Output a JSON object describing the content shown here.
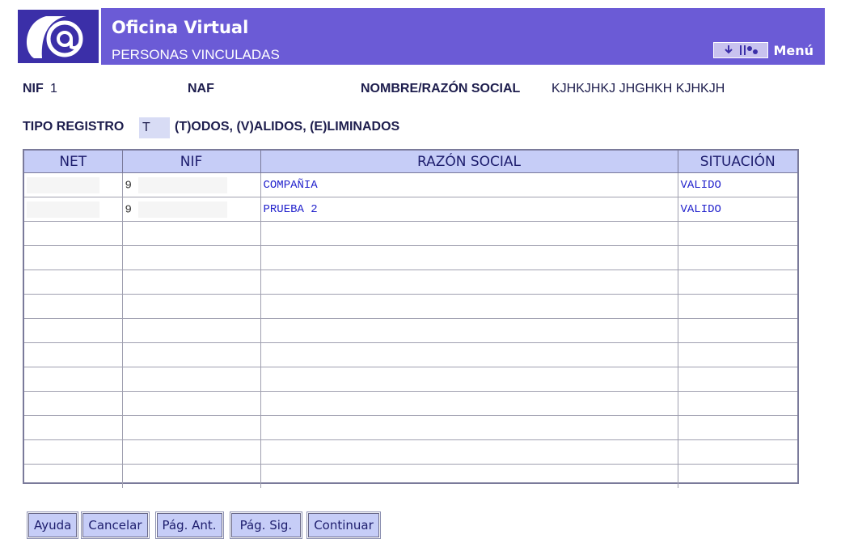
{
  "header": {
    "app_title": "Oficina Virtual",
    "page_subtitle": "PERSONAS VINCULADAS",
    "menu_label": "Menú",
    "brand_color": "#6b5bd6"
  },
  "info": {
    "nif_label": "NIF",
    "nif_value": "1",
    "naf_label": "NAF",
    "naf_value": "",
    "nombre_label": "NOMBRE/RAZÓN SOCIAL",
    "nombre_value": "KJHKJHKJ JHGHKH KJHKJH",
    "tipo_label": "TIPO REGISTRO",
    "tipo_value": "T",
    "tipo_hint": "(T)ODOS, (V)ALIDOS, (E)LIMINADOS"
  },
  "table": {
    "columns": [
      "NET",
      "NIF",
      "RAZÓN SOCIAL",
      "SITUACIÓN"
    ],
    "rows": [
      {
        "net": "",
        "nif": "9",
        "razon": "COMPAÑIA",
        "situacion": "VALIDO"
      },
      {
        "net": "",
        "nif": "9",
        "razon": "PRUEBA 2",
        "situacion": "VALIDO"
      }
    ]
  },
  "buttons": {
    "ayuda": "Ayuda",
    "cancelar": "Cancelar",
    "pag_ant": "Pág. Ant.",
    "pag_sig": "Pág. Sig.",
    "continuar": "Continuar"
  }
}
